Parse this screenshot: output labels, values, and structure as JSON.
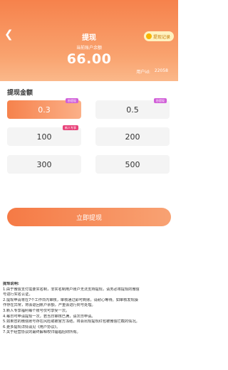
{
  "header": {
    "title": "提现",
    "record_label": "提现记录",
    "balance_label": "当前账户余额",
    "balance_value": "66.00",
    "user_id_label": "用户id:",
    "user_id_value": "22058"
  },
  "section_title": "提现金额",
  "options": [
    {
      "amount": "0.3",
      "badge": "秒提现",
      "selected": true
    },
    {
      "amount": "0.5",
      "badge": "秒提现",
      "selected": false
    },
    {
      "amount": "100",
      "badge": "新人专享",
      "selected": false
    },
    {
      "amount": "200",
      "badge": "",
      "selected": false
    },
    {
      "amount": "300",
      "badge": "",
      "selected": false
    },
    {
      "amount": "500",
      "badge": "",
      "selected": false
    }
  ],
  "withdraw_button": "立即提现",
  "notes": [
    "提现说明:",
    "1.由于微信支付需要实名制，非实名制用户账户无法支持提现，请务必将提现的微信",
    "号进行实名认证。",
    "2.提现申请将在7个工作日内审核，审核通过即可到账，请耐心等待。如审核发现操",
    "作存在异常，将会退回账户余额，严重会进行封号处理。",
    "3.新人专享福利每个账号仅可享受一次。",
    "4.每日可申请提现一次，若当日审核已满，请次日申请。",
    "5.如果您的微信账号存在风险或被官方冻结，将会出现提现红包被微信拦截的情况。",
    "6.更多提现详情请见《用户协议》。",
    "7.关于经营协议的最终解释权归福临招财所有。"
  ]
}
